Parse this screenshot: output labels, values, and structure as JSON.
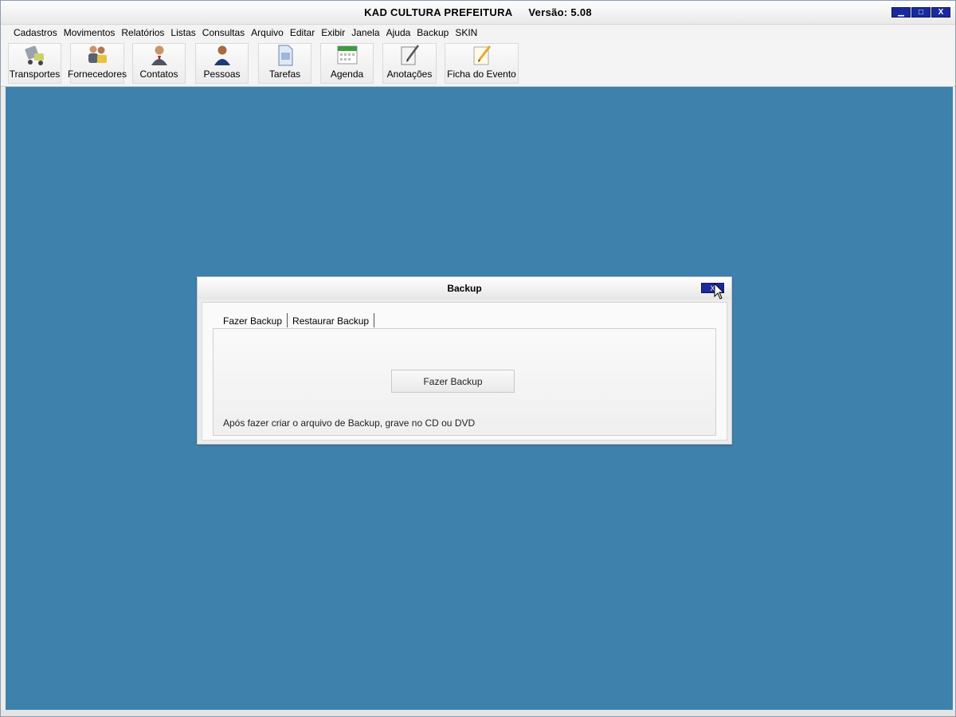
{
  "window": {
    "app_name": "KAD CULTURA PREFEITURA",
    "version": "Versão: 5.08",
    "controls": {
      "minimize": "▁",
      "maximize": "□",
      "close": "X"
    }
  },
  "menu": [
    "Cadastros",
    "Movimentos",
    "Relatórios",
    "Listas",
    "Consultas",
    "Arquivo",
    "Editar",
    "Exibir",
    "Janela",
    "Ajuda",
    "Backup",
    "SKIN"
  ],
  "toolbar": [
    {
      "label": "Transportes",
      "icon": "truck-icon"
    },
    {
      "label": "Fornecedores",
      "icon": "suppliers-icon"
    },
    {
      "label": "Contatos",
      "icon": "contact-person-icon"
    },
    {
      "label": "Pessoas",
      "icon": "person-icon"
    },
    {
      "label": "Tarefas",
      "icon": "document-icon"
    },
    {
      "label": "Agenda",
      "icon": "calendar-icon"
    },
    {
      "label": "Anotações",
      "icon": "notepad-pen-icon"
    },
    {
      "label": "Ficha do Evento",
      "icon": "note-pencil-icon"
    }
  ],
  "dialog": {
    "title": "Backup",
    "close": "X",
    "tabs": [
      "Fazer Backup",
      "Restaurar Backup"
    ],
    "button": "Fazer Backup",
    "hint": "Após fazer criar o arquivo de Backup, grave no CD ou DVD"
  },
  "colors": {
    "desktop": "#3f81ad",
    "window_button": "#1a2a9e"
  }
}
